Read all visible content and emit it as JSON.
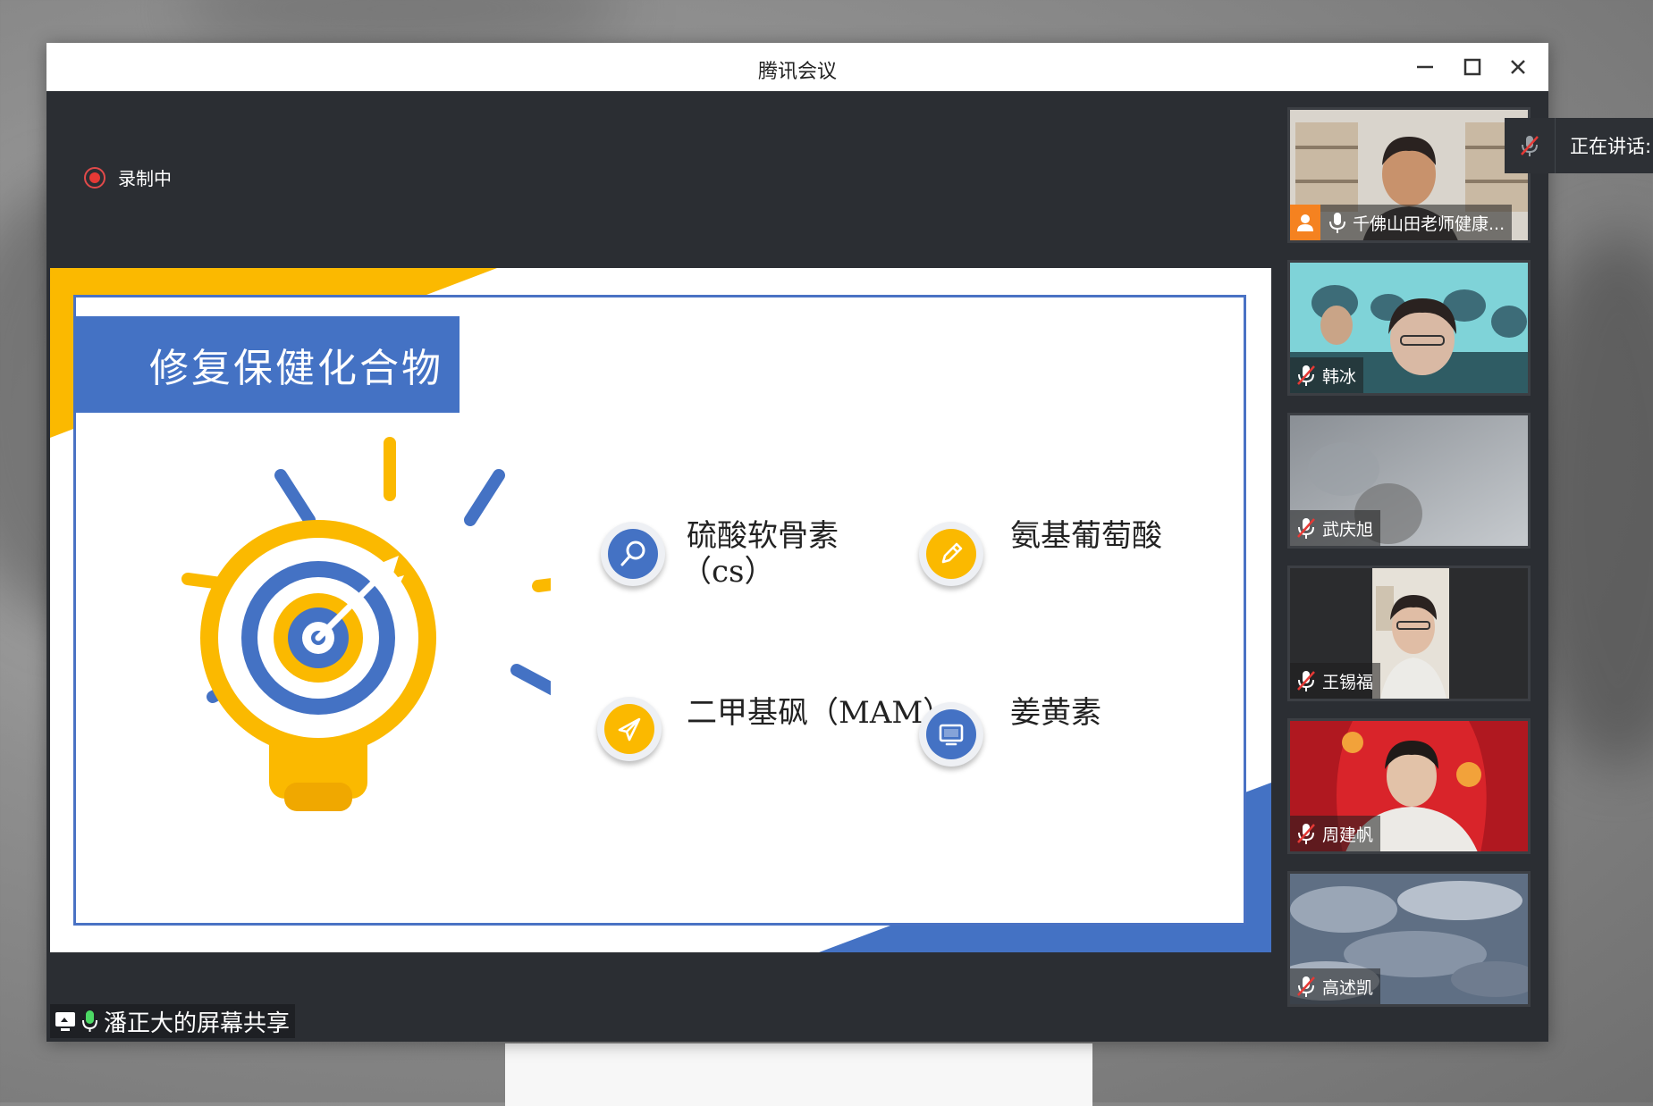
{
  "app": {
    "title": "腾讯会议"
  },
  "window_controls": {
    "minimize": "minimize-icon",
    "maximize": "maximize-icon",
    "close": "close-icon"
  },
  "recording": {
    "label": "录制中",
    "color": "#e53935"
  },
  "slide": {
    "heading": "修复保健化合物",
    "items": [
      {
        "name": "硫酸软骨素",
        "sub": "（cs）",
        "icon": "search-icon",
        "color": "#4472c4"
      },
      {
        "name": "氨基葡萄酸",
        "icon": "pencil-icon",
        "color": "#fbb900"
      },
      {
        "name": "二甲基砜（MAM）",
        "icon": "paper-plane-icon",
        "color": "#fbb900"
      },
      {
        "name": "姜黄素",
        "icon": "monitor-icon",
        "color": "#4472c4"
      }
    ],
    "colors": {
      "blue": "#4472c4",
      "yellow": "#fbb900"
    }
  },
  "sharer": {
    "label": "潘正大的屏幕共享"
  },
  "participants": [
    {
      "name": "千佛山田老师健康...",
      "muted": false,
      "host": true
    },
    {
      "name": "韩冰",
      "muted": true
    },
    {
      "name": "武庆旭",
      "muted": true
    },
    {
      "name": "王锡福",
      "muted": true
    },
    {
      "name": "周建帆",
      "muted": true
    },
    {
      "name": "高述凯",
      "muted": true
    }
  ],
  "speaking": {
    "label": "正在讲话:"
  }
}
